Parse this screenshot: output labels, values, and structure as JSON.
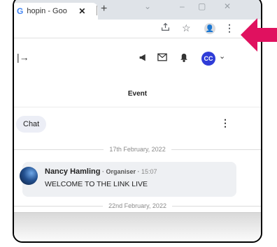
{
  "browser": {
    "tab_logo": "G",
    "tab_title": "hopin - Goo",
    "tab_close": "✕",
    "new_tab": "+",
    "window_controls": [
      "⌄",
      "–",
      "▢",
      "✕"
    ],
    "toolbar_icons": [
      "share-icon",
      "star-icon",
      "profile-icon",
      "menu-kebab-icon"
    ]
  },
  "header": {
    "exit_glyph": "|→",
    "avatar_initials": "CC"
  },
  "event": {
    "title": "Event",
    "chat_tab": "Chat"
  },
  "messages": {
    "date1": "17th February, 2022",
    "sender": "Nancy Hamling",
    "role": "Organiser",
    "separator": " · ",
    "time": "15:07",
    "text": "WELCOME TO THE LINK LIVE",
    "date2": "22nd February, 2022"
  },
  "colors": {
    "arrow": "#e0115f",
    "avatar": "#2f3cd7"
  }
}
